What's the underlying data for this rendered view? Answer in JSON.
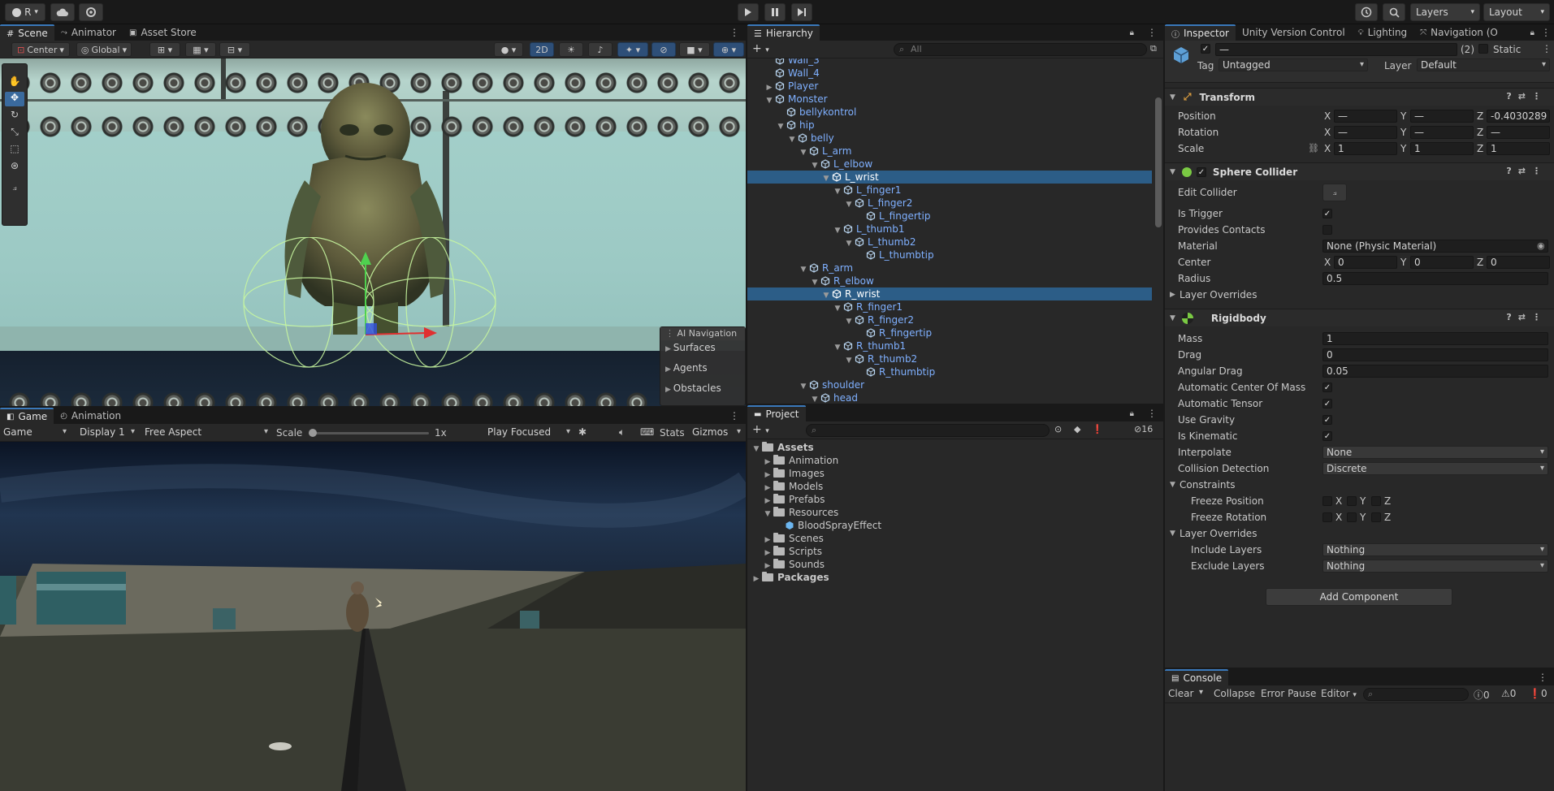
{
  "topbar": {
    "account": "R",
    "layers": "Layers",
    "layout": "Layout"
  },
  "scene_panel": {
    "tabs": [
      "Scene",
      "Animator",
      "Asset Store"
    ],
    "toolbar": {
      "pivot": "Center",
      "space": "Global",
      "mode_2d": "2D"
    },
    "overlay": {
      "title": "AI Navigation",
      "items": [
        "Surfaces",
        "Agents",
        "Obstacles"
      ]
    }
  },
  "game_panel": {
    "tabs": [
      "Game",
      "Animation"
    ],
    "toolbar": {
      "view": "Game",
      "display": "Display 1",
      "aspect": "Free Aspect",
      "scale_label": "Scale",
      "scale_value": "1x",
      "play_mode": "Play Focused",
      "stats": "Stats",
      "gizmos": "Gizmos"
    }
  },
  "hierarchy": {
    "tab": "Hierarchy",
    "search_placeholder": "All",
    "rows": [
      {
        "label": "Wall_3",
        "depth": 2,
        "arrow": "",
        "selected": false
      },
      {
        "label": "Wall_4",
        "depth": 2,
        "arrow": "",
        "selected": false
      },
      {
        "label": "Player",
        "depth": 2,
        "arrow": "right",
        "selected": false
      },
      {
        "label": "Monster",
        "depth": 2,
        "arrow": "down",
        "selected": false
      },
      {
        "label": "bellykontrol",
        "depth": 3,
        "arrow": "",
        "selected": false
      },
      {
        "label": "hip",
        "depth": 3,
        "arrow": "down",
        "selected": false
      },
      {
        "label": "belly",
        "depth": 4,
        "arrow": "down",
        "selected": false
      },
      {
        "label": "L_arm",
        "depth": 5,
        "arrow": "down",
        "selected": false
      },
      {
        "label": "L_elbow",
        "depth": 6,
        "arrow": "down",
        "selected": false
      },
      {
        "label": "L_wrist",
        "depth": 7,
        "arrow": "down",
        "selected": true
      },
      {
        "label": "L_finger1",
        "depth": 8,
        "arrow": "down",
        "selected": false
      },
      {
        "label": "L_finger2",
        "depth": 9,
        "arrow": "down",
        "selected": false
      },
      {
        "label": "L_fingertip",
        "depth": 10,
        "arrow": "",
        "selected": false
      },
      {
        "label": "L_thumb1",
        "depth": 8,
        "arrow": "down",
        "selected": false
      },
      {
        "label": "L_thumb2",
        "depth": 9,
        "arrow": "down",
        "selected": false
      },
      {
        "label": "L_thumbtip",
        "depth": 10,
        "arrow": "",
        "selected": false
      },
      {
        "label": "R_arm",
        "depth": 5,
        "arrow": "down",
        "selected": false
      },
      {
        "label": "R_elbow",
        "depth": 6,
        "arrow": "down",
        "selected": false
      },
      {
        "label": "R_wrist",
        "depth": 7,
        "arrow": "down",
        "selected": true
      },
      {
        "label": "R_finger1",
        "depth": 8,
        "arrow": "down",
        "selected": false
      },
      {
        "label": "R_finger2",
        "depth": 9,
        "arrow": "down",
        "selected": false
      },
      {
        "label": "R_fingertip",
        "depth": 10,
        "arrow": "",
        "selected": false
      },
      {
        "label": "R_thumb1",
        "depth": 8,
        "arrow": "down",
        "selected": false
      },
      {
        "label": "R_thumb2",
        "depth": 9,
        "arrow": "down",
        "selected": false
      },
      {
        "label": "R_thumbtip",
        "depth": 10,
        "arrow": "",
        "selected": false
      },
      {
        "label": "shoulder",
        "depth": 5,
        "arrow": "down",
        "selected": false
      },
      {
        "label": "head",
        "depth": 6,
        "arrow": "down",
        "selected": false
      }
    ]
  },
  "project": {
    "tab": "Project",
    "hidden_count": "16",
    "rows": [
      {
        "label": "Assets",
        "depth": 0,
        "arrow": "down",
        "bold": true,
        "type": "folder"
      },
      {
        "label": "Animation",
        "depth": 1,
        "arrow": "right",
        "bold": false,
        "type": "folder"
      },
      {
        "label": "Images",
        "depth": 1,
        "arrow": "right",
        "bold": false,
        "type": "folder"
      },
      {
        "label": "Models",
        "depth": 1,
        "arrow": "right",
        "bold": false,
        "type": "folder"
      },
      {
        "label": "Prefabs",
        "depth": 1,
        "arrow": "right",
        "bold": false,
        "type": "folder"
      },
      {
        "label": "Resources",
        "depth": 1,
        "arrow": "down",
        "bold": false,
        "type": "folder-open"
      },
      {
        "label": "BloodSprayEffect",
        "depth": 2,
        "arrow": "",
        "bold": false,
        "type": "prefab"
      },
      {
        "label": "Scenes",
        "depth": 1,
        "arrow": "right",
        "bold": false,
        "type": "folder"
      },
      {
        "label": "Scripts",
        "depth": 1,
        "arrow": "right",
        "bold": false,
        "type": "folder"
      },
      {
        "label": "Sounds",
        "depth": 1,
        "arrow": "right",
        "bold": false,
        "type": "folder"
      },
      {
        "label": "Packages",
        "depth": 0,
        "arrow": "right",
        "bold": true,
        "type": "folder"
      }
    ]
  },
  "inspector": {
    "tabs": [
      "Inspector",
      "Unity Version Control",
      "Lighting",
      "Navigation (O"
    ],
    "object_name": "—",
    "multi_count": "(2)",
    "static_label": "Static",
    "tag_label": "Tag",
    "tag_value": "Untagged",
    "layer_label": "Layer",
    "layer_value": "Default",
    "transform": {
      "title": "Transform",
      "position_label": "Position",
      "pos_x": "—",
      "pos_y": "—",
      "pos_z": "-0.4030289",
      "rotation_label": "Rotation",
      "rot_x": "—",
      "rot_y": "—",
      "rot_z": "—",
      "scale_label": "Scale",
      "scale_x": "1",
      "scale_y": "1",
      "scale_z": "1"
    },
    "sphere_collider": {
      "title": "Sphere Collider",
      "edit_collider": "Edit Collider",
      "is_trigger": "Is Trigger",
      "provides_contacts": "Provides Contacts",
      "material_label": "Material",
      "material_value": "None (Physic Material)",
      "center_label": "Center",
      "center_x": "0",
      "center_y": "0",
      "center_z": "0",
      "radius_label": "Radius",
      "radius_value": "0.5",
      "layer_overrides": "Layer Overrides"
    },
    "rigidbody": {
      "title": "Rigidbody",
      "mass_label": "Mass",
      "mass": "1",
      "drag_label": "Drag",
      "drag": "0",
      "angular_drag_label": "Angular Drag",
      "angular_drag": "0.05",
      "auto_com": "Automatic Center Of Mass",
      "auto_tensor": "Automatic Tensor",
      "use_gravity": "Use Gravity",
      "is_kinematic": "Is Kinematic",
      "interpolate_label": "Interpolate",
      "interpolate": "None",
      "collision_label": "Collision Detection",
      "collision": "Discrete",
      "constraints": "Constraints",
      "freeze_position": "Freeze Position",
      "freeze_rotation": "Freeze Rotation",
      "layer_overrides": "Layer Overrides",
      "include_label": "Include Layers",
      "include": "Nothing",
      "exclude_label": "Exclude Layers",
      "exclude": "Nothing"
    },
    "add_component": "Add Component",
    "axis_x": "X",
    "axis_y": "Y",
    "axis_z": "Z"
  },
  "console": {
    "tab": "Console",
    "clear": "Clear",
    "collapse": "Collapse",
    "error_pause": "Error Pause",
    "editor": "Editor",
    "log_count": "0",
    "warn_count": "0",
    "error_count": "0"
  }
}
